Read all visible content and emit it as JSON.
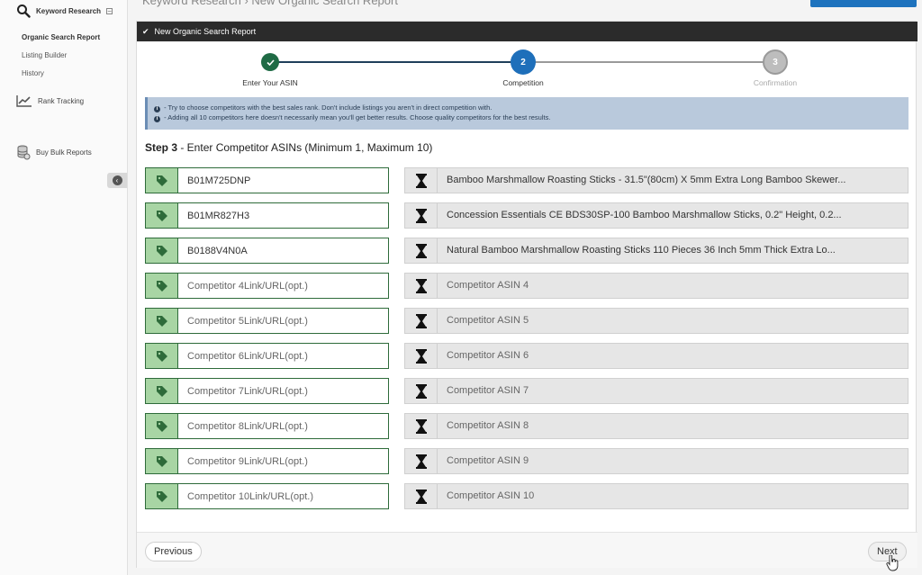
{
  "sidebar": {
    "section_title": "Keyword Research",
    "links": [
      "Organic Search Report",
      "Listing Builder",
      "History"
    ],
    "rank_tracking": "Rank Tracking",
    "bulk_reports": "Buy Bulk Reports"
  },
  "top": {
    "crumb": "Keyword Research  ›  New Organic Search Report"
  },
  "panel": {
    "header": "New Organic Search Report",
    "steps": [
      {
        "number": "1",
        "label": "Enter Your ASIN",
        "state": "complete"
      },
      {
        "number": "2",
        "label": "Competition",
        "state": "active"
      },
      {
        "number": "3",
        "label": "Confirmation",
        "state": "pending"
      }
    ],
    "info_lines": [
      " - Try to choose competitors with the best sales rank. Don't include listings you aren't in direct competition with.",
      " - Adding all 10 competitors here doesn't necessarily mean you'll get better results. Choose quality competitors for the best results."
    ],
    "step_title_bold": "Step 3",
    "step_title_rest": " - Enter Competitor ASINs (Minimum 1, Maximum 10)",
    "rows": [
      {
        "asin": "B01M725DNP",
        "placeholder": "Competitor 1Link/URL(opt.)",
        "title": "Bamboo Marshmallow Roasting Sticks - 31.5\"(80cm) X 5mm Extra Long Bamboo Skewer...",
        "filled": true
      },
      {
        "asin": "B01MR827H3",
        "placeholder": "Competitor 2Link/URL(opt.)",
        "title": "Concession Essentials CE BDS30SP-100 Bamboo Marshmallow Sticks, 0.2\" Height, 0.2...",
        "filled": true
      },
      {
        "asin": "B0188V4N0A",
        "placeholder": "Competitor 3Link/URL(opt.)",
        "title": "Natural Bamboo Marshmallow Roasting Sticks 110 Pieces 36 Inch 5mm Thick Extra Lo...",
        "filled": true
      },
      {
        "asin": "",
        "placeholder": "Competitor 4Link/URL(opt.)",
        "title": "Competitor ASIN 4",
        "filled": false
      },
      {
        "asin": "",
        "placeholder": "Competitor 5Link/URL(opt.)",
        "title": "Competitor ASIN 5",
        "filled": false
      },
      {
        "asin": "",
        "placeholder": "Competitor 6Link/URL(opt.)",
        "title": "Competitor ASIN 6",
        "filled": false
      },
      {
        "asin": "",
        "placeholder": "Competitor 7Link/URL(opt.)",
        "title": "Competitor ASIN 7",
        "filled": false
      },
      {
        "asin": "",
        "placeholder": "Competitor 8Link/URL(opt.)",
        "title": "Competitor ASIN 8",
        "filled": false
      },
      {
        "asin": "",
        "placeholder": "Competitor 9Link/URL(opt.)",
        "title": "Competitor ASIN 9",
        "filled": false
      },
      {
        "asin": "",
        "placeholder": "Competitor 10Link/URL(opt.)",
        "title": "Competitor ASIN 10",
        "filled": false
      }
    ],
    "previous_label": "Previous",
    "next_label": "Next"
  },
  "colors": {
    "complete": "#1f6b45",
    "active": "#1e6fba",
    "pending": "#bdbdbd",
    "tag_bg": "#a8d5a4",
    "tag_border": "#2e6b3a",
    "header_bg": "#2b2b2b",
    "info_bg": "#b9c9dc"
  },
  "icons": {
    "sidebar_search": "magnifier-icon",
    "rank": "trend-chart-icon",
    "bulk": "coin-stack-icon",
    "collapse": "chevron-left-circle-icon",
    "row_tag": "price-tag-icon",
    "row_status": "hourglass-icon"
  }
}
